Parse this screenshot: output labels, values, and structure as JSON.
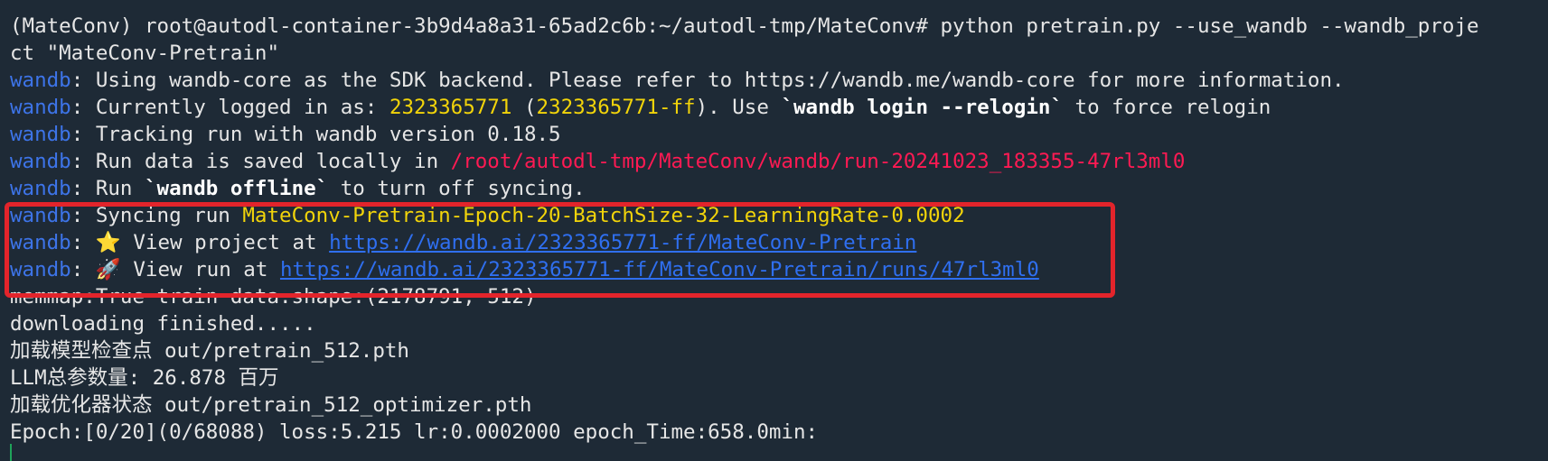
{
  "terminal": {
    "prompt_line1": "(MateConv) root@autodl-container-3b9d4a8a31-65ad2c6b:~/autodl-tmp/MateConv# python pretrain.py --use_wandb --wandb_proje",
    "prompt_line2": "ct \"MateConv-Pretrain\"",
    "wandb_prefix": "wandb",
    "colon": ": ",
    "l3_text": "Using wandb-core as the SDK backend. Please refer to https://wandb.me/wandb-core for more information.",
    "l4_a": "Currently logged in as: ",
    "l4_user": "2323365771",
    "l4_b": " (",
    "l4_team": "2323365771-ff",
    "l4_c": "). Use ",
    "l4_cmd": "`wandb login --relogin`",
    "l4_d": " to force relogin",
    "l5_text": "Tracking run with wandb version 0.18.5",
    "l6_a": "Run data is saved locally in ",
    "l6_path": "/root/autodl-tmp/MateConv/wandb/run-20241023_183355-47rl3ml0",
    "l7_a": "Run ",
    "l7_cmd": "`wandb offline`",
    "l7_b": " to turn off syncing.",
    "l8_a": "Syncing run ",
    "l8_run": "MateConv-Pretrain-Epoch-20-BatchSize-32-LearningRate-0.0002",
    "l9_a": "⭐ View project at ",
    "l9_link": "https://wandb.ai/2323365771-ff/MateConv-Pretrain",
    "l10_a": "🚀 View run at ",
    "l10_link": "https://wandb.ai/2323365771-ff/MateConv-Pretrain/runs/47rl3ml0",
    "l11_text": "memmap:True train data.shape:(2178791, 512)",
    "l12_text": "downloading finished.....",
    "l13_text": "加载模型检查点 out/pretrain_512.pth",
    "l14_text": "LLM总参数量: 26.878 百万",
    "l15_text": "加载优化器状态 out/pretrain_512_optimizer.pth",
    "l16_text": "Epoch:[0/20](0/68088) loss:5.215 lr:0.0002000 epoch_Time:658.0min:"
  },
  "colors": {
    "background": "#1e2a36",
    "foreground": "#e6e6e6",
    "wandb_blue": "#3d74e8",
    "yellow": "#f2d40a",
    "red_path": "#ff1a53",
    "link_blue": "#2f6ff0",
    "highlight_box": "#e3242b",
    "cursor": "#1fa35a"
  }
}
